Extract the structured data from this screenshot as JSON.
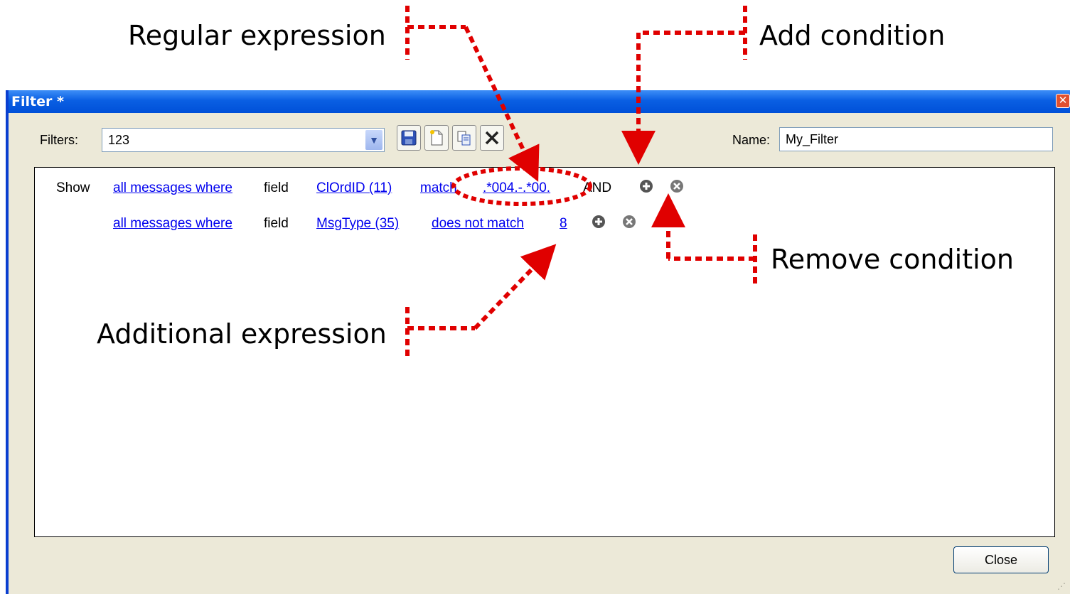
{
  "annotations": {
    "regular_expression": "Regular expression",
    "add_condition": "Add condition",
    "remove_condition": "Remove condition",
    "additional_expression": "Additional expression"
  },
  "window": {
    "title": "Filter *"
  },
  "toolbar": {
    "filters_label": "Filters:",
    "filters_value": "123",
    "name_label": "Name:",
    "name_value": "My_Filter"
  },
  "conditions": [
    {
      "prefix": "Show",
      "scope": "all messages where",
      "field_word": "field",
      "field": "ClOrdID (11)",
      "operator": "match",
      "value": ".*004.-.*00.",
      "conjunction": "AND"
    },
    {
      "prefix": "",
      "scope": "all messages where",
      "field_word": "field",
      "field": "MsgType (35)",
      "operator": "does not match",
      "value": "8",
      "conjunction": ""
    }
  ],
  "footer": {
    "close_label": "Close"
  },
  "colors": {
    "annotation": "#e00000",
    "link": "#0000ee",
    "titlebar": "#0a5fe3"
  }
}
